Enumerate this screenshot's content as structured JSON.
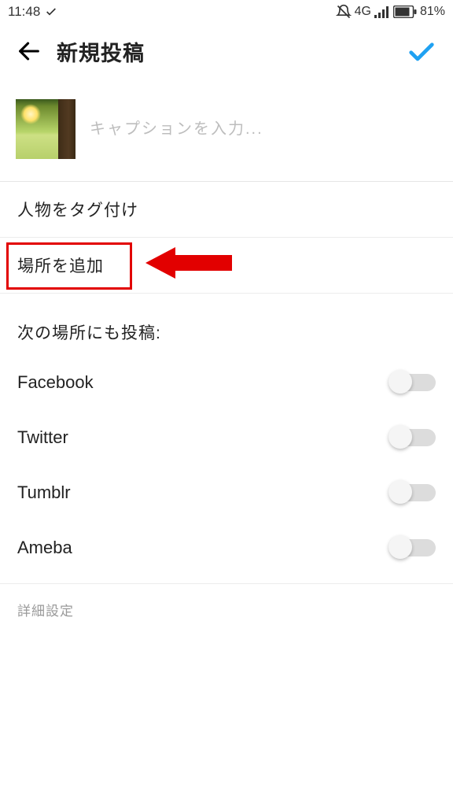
{
  "status": {
    "time": "11:48",
    "network": "4G",
    "battery_pct": "81%"
  },
  "header": {
    "title": "新規投稿"
  },
  "caption": {
    "placeholder": "キャプションを入力..."
  },
  "rows": {
    "tag_people": "人物をタグ付け",
    "add_location": "場所を追加"
  },
  "share": {
    "section_label": "次の場所にも投稿:",
    "platforms": [
      {
        "name": "Facebook",
        "enabled": false
      },
      {
        "name": "Twitter",
        "enabled": false
      },
      {
        "name": "Tumblr",
        "enabled": false
      },
      {
        "name": "Ameba",
        "enabled": false
      }
    ]
  },
  "advanced_label": "詳細設定"
}
